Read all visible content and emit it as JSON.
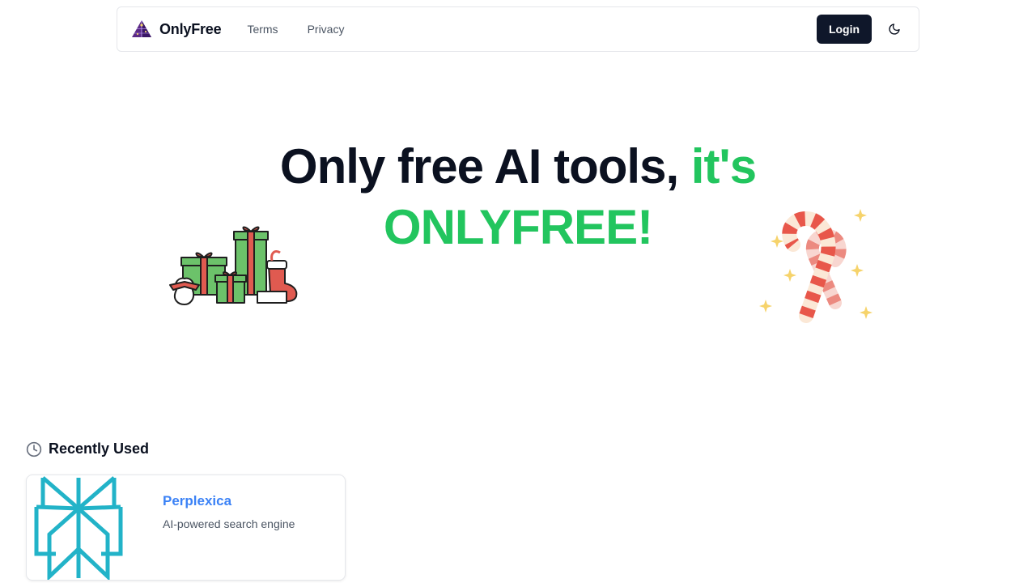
{
  "nav": {
    "brand": "OnlyFree",
    "links": [
      "Terms",
      "Privacy"
    ],
    "login_label": "Login",
    "theme_toggle_icon": "moon-icon"
  },
  "hero": {
    "line1_dark": "Only free AI tools,",
    "line1_green": "it's",
    "line2_green": "ONLYFREE!",
    "accent_color": "#22c55e"
  },
  "recently_used": {
    "title": "Recently Used",
    "icon": "clock-icon",
    "items": [
      {
        "name": "Perplexica",
        "description": "AI-powered search engine",
        "logo": "perplexica-logo"
      }
    ]
  },
  "decorations": [
    "christmas-gifts",
    "candy-canes"
  ]
}
